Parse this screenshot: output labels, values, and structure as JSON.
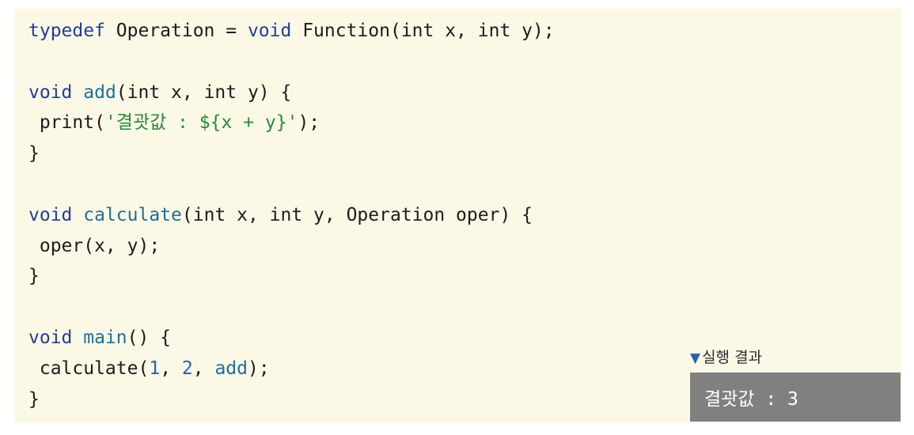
{
  "code": {
    "lines": [
      [
        {
          "t": "typedef",
          "c": "kw"
        },
        {
          "t": " Operation = ",
          "c": "plain"
        },
        {
          "t": "void",
          "c": "kw"
        },
        {
          "t": " Function(int x, int y);",
          "c": "plain"
        }
      ],
      [],
      [
        {
          "t": "void",
          "c": "kw"
        },
        {
          "t": " ",
          "c": "plain"
        },
        {
          "t": "add",
          "c": "fn"
        },
        {
          "t": "(int x, int y) {",
          "c": "plain"
        }
      ],
      [
        {
          "t": " print(",
          "c": "plain"
        },
        {
          "t": "'결괏값 : ${x + y}'",
          "c": "str"
        },
        {
          "t": ");",
          "c": "plain"
        }
      ],
      [
        {
          "t": "}",
          "c": "plain"
        }
      ],
      [],
      [
        {
          "t": "void",
          "c": "kw"
        },
        {
          "t": " ",
          "c": "plain"
        },
        {
          "t": "calculate",
          "c": "fn"
        },
        {
          "t": "(int x, int y, Operation oper) {",
          "c": "plain"
        }
      ],
      [
        {
          "t": " oper(x, y);",
          "c": "plain"
        }
      ],
      [
        {
          "t": "}",
          "c": "plain"
        }
      ],
      [],
      [
        {
          "t": "void",
          "c": "kw"
        },
        {
          "t": " ",
          "c": "plain"
        },
        {
          "t": "main",
          "c": "fn"
        },
        {
          "t": "() {",
          "c": "plain"
        }
      ],
      [
        {
          "t": " calculate(",
          "c": "plain"
        },
        {
          "t": "1",
          "c": "num"
        },
        {
          "t": ", ",
          "c": "plain"
        },
        {
          "t": "2",
          "c": "num"
        },
        {
          "t": ", ",
          "c": "plain"
        },
        {
          "t": "add",
          "c": "fn"
        },
        {
          "t": ");",
          "c": "plain"
        }
      ],
      [
        {
          "t": "}",
          "c": "plain"
        }
      ]
    ]
  },
  "result": {
    "icon": "triangle-down-icon",
    "label": "실행 결과",
    "output": "결괏값 : 3"
  },
  "colors": {
    "panel_bg": "#fbf8e6",
    "keyword": "#1f3f96",
    "function": "#1f6f99",
    "string": "#2a8a3e",
    "number": "#2a5fb0",
    "result_bg": "#808080"
  }
}
